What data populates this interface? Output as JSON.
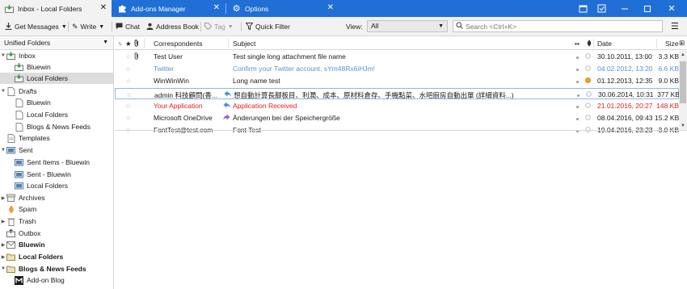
{
  "tabs": [
    {
      "label": "Inbox - Local Folders",
      "icon": "inbox-icon"
    },
    {
      "label": "Add-ons Manager",
      "icon": "puzzle-icon"
    },
    {
      "label": "Options",
      "icon": "gear-icon"
    }
  ],
  "window_controls": [
    "calendar-icon",
    "tasks-icon",
    "minimize",
    "maximize",
    "close"
  ],
  "toolbar": {
    "get_messages": "Get Messages",
    "write": "Write",
    "chat": "Chat",
    "address_book": "Address Book",
    "tag": "Tag",
    "quick_filter": "Quick Filter",
    "view_label": "View:",
    "view_value": "All",
    "search_placeholder": "Search <Ctrl+K>"
  },
  "folder_pane": {
    "header": "Unified Folders",
    "items": [
      {
        "label": "Inbox",
        "level": 0,
        "twisty": "open",
        "icon": "inbox-icon"
      },
      {
        "label": "Bluewin",
        "level": 1,
        "icon": "inbox-icon"
      },
      {
        "label": "Local Folders",
        "level": 1,
        "icon": "inbox-icon",
        "selected": true
      },
      {
        "label": "Drafts",
        "level": 0,
        "twisty": "open",
        "icon": "drafts-icon"
      },
      {
        "label": "Bluewin",
        "level": 1,
        "icon": "drafts-icon"
      },
      {
        "label": "Local Folders",
        "level": 1,
        "icon": "drafts-icon"
      },
      {
        "label": "Blogs & News Feeds",
        "level": 1,
        "icon": "drafts-icon"
      },
      {
        "label": "Templates",
        "level": 0,
        "icon": "templates-icon"
      },
      {
        "label": "Sent",
        "level": 0,
        "twisty": "open",
        "icon": "sent-icon"
      },
      {
        "label": "Sent Items - Bluewin",
        "level": 1,
        "icon": "sent-icon"
      },
      {
        "label": "Sent - Bluewin",
        "level": 1,
        "icon": "sent-icon"
      },
      {
        "label": "Local Folders",
        "level": 1,
        "icon": "sent-icon"
      },
      {
        "label": "Archives",
        "level": 0,
        "twisty": "closed",
        "icon": "archive-icon"
      },
      {
        "label": "Spam",
        "level": 0,
        "icon": "spam-icon"
      },
      {
        "label": "Trash",
        "level": 0,
        "twisty": "closed",
        "icon": "trash-icon"
      },
      {
        "label": "Outbox",
        "level": 0,
        "icon": "outbox-icon"
      },
      {
        "label": "Bluewin",
        "level": 0,
        "twisty": "closed",
        "icon": "account-icon",
        "bold": true
      },
      {
        "label": "Local Folders",
        "level": 0,
        "twisty": "closed",
        "icon": "local-folders-icon",
        "bold": true
      },
      {
        "label": "Blogs & News Feeds",
        "level": 0,
        "twisty": "open",
        "icon": "feeds-icon",
        "bold": true
      },
      {
        "label": "Add-on Blog",
        "level": 1,
        "icon": "blog-icon"
      }
    ]
  },
  "thread_pane": {
    "columns": {
      "correspondents": "Correspondents",
      "subject": "Subject",
      "date": "Date",
      "size": "Size"
    },
    "rows": [
      {
        "correspondent": "Test User",
        "subject": "Test single long attachment file name",
        "date": "30.10.2011, 13:00",
        "size": "3.3 KB",
        "attachment": true,
        "style": "normal",
        "arrow": "",
        "dot": "grey"
      },
      {
        "correspondent": "Twitter",
        "subject": "Confirm your Twitter account, sYm48Rx6iHJm!",
        "date": "04.02.2012, 13:20",
        "size": "6.6 KB",
        "attachment": false,
        "style": "unread-blue",
        "arrow": "",
        "dot": "grey"
      },
      {
        "correspondent": "WinWinWin",
        "subject": "Long name test",
        "date": "01.12.2013, 12:35",
        "size": "9.0 KB",
        "attachment": false,
        "style": "normal",
        "arrow": "",
        "dot": "orange"
      },
      {
        "correspondent": "admin 科技顧問(香...",
        "subject": "想自動計算長腳板目、利潤、成本、原材料倉存、手機點菜、水吧廚房自動出單 (詳細資料...)",
        "date": "30.06.2014, 10:31",
        "size": "377 KB",
        "attachment": false,
        "style": "normal",
        "arrow": "reply",
        "dot": "grey",
        "selected": true
      },
      {
        "correspondent": "Your Application",
        "subject": "Application Received",
        "date": "21.01.2016, 20:27",
        "size": "148 KB",
        "attachment": false,
        "style": "red",
        "arrow": "reply",
        "dot": "grey"
      },
      {
        "correspondent": "Microsoft OneDrive",
        "subject": "Änderungen bei der Speichergröße",
        "date": "08.04.2016, 09:43",
        "size": "15.2 KB",
        "attachment": false,
        "style": "normal",
        "arrow": "forward",
        "dot": "grey"
      },
      {
        "correspondent": "FontTest@test.com",
        "subject": "Font Test",
        "date": "19.04.2016, 23:23",
        "size": "3.0 KB",
        "attachment": false,
        "style": "normal",
        "arrow": "",
        "dot": "grey"
      }
    ]
  },
  "colors": {
    "titlebar": "#1f6fd6",
    "selection": "#dcdcdc",
    "unread_blue": "#5b8fd6",
    "tag_red": "#e0201e"
  }
}
